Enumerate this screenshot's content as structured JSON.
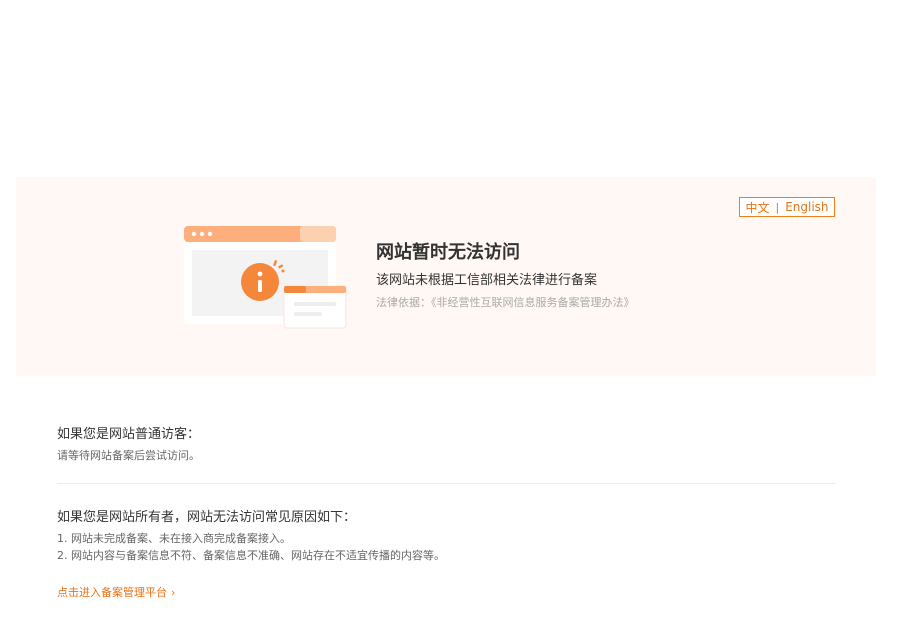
{
  "lang_switch": {
    "zh": "中文",
    "separator": "|",
    "en": "English"
  },
  "notice": {
    "title": "网站暂时无法访问",
    "subtitle": "该网站未根据工信部相关法律进行备案",
    "law": "法律依据：《非经营性互联网信息服务备案管理办法》"
  },
  "visitor": {
    "title": "如果您是网站普通访客：",
    "text": "请等待网站备案后尝试访问。"
  },
  "owner": {
    "title": "如果您是网站所有者，网站无法访问常见原因如下：",
    "reasons": [
      "1. 网站未完成备案、未在接入商完成备案接入。",
      "2. 网站内容与备案信息不符、备案信息不准确、网站存在不适宜传播的内容等。"
    ]
  },
  "link": {
    "label": "点击进入备案管理平台",
    "chevron": "›"
  },
  "colors": {
    "accent": "#e87316",
    "banner_bg": "#fff8f4"
  },
  "icons": {
    "illustration": "browser-window-info-icon"
  }
}
